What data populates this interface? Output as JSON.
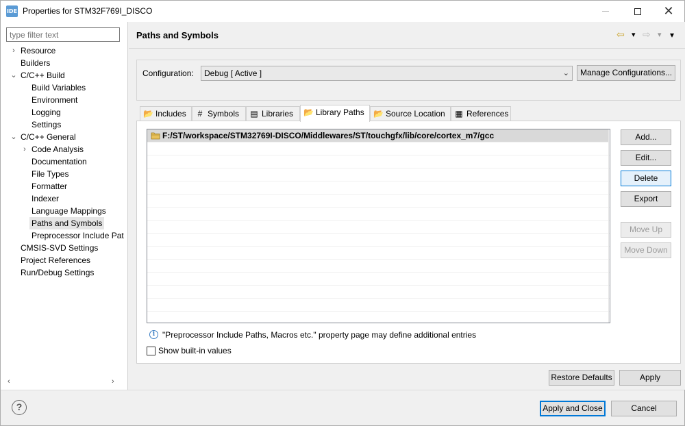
{
  "window": {
    "app_icon": "IDE",
    "title": "Properties for STM32F769I_DISCO",
    "minimize_icon": "minimize-icon",
    "maximize_icon": "maximize-icon",
    "close_glyph": "✕"
  },
  "sidebar": {
    "filter_placeholder": "type filter text",
    "items": [
      {
        "label": "Resource",
        "expander": "›"
      },
      {
        "label": "Builders"
      },
      {
        "label": "C/C++ Build",
        "expander": "⌄"
      },
      {
        "label": "Build Variables"
      },
      {
        "label": "Environment"
      },
      {
        "label": "Logging"
      },
      {
        "label": "Settings"
      },
      {
        "label": "C/C++ General",
        "expander": "⌄"
      },
      {
        "label": "Code Analysis",
        "expander": "›"
      },
      {
        "label": "Documentation"
      },
      {
        "label": "File Types"
      },
      {
        "label": "Formatter"
      },
      {
        "label": "Indexer"
      },
      {
        "label": "Language Mappings"
      },
      {
        "label": "Paths and Symbols",
        "selected": true
      },
      {
        "label": "Preprocessor Include Pat"
      },
      {
        "label": "CMSIS-SVD Settings"
      },
      {
        "label": "Project References"
      },
      {
        "label": "Run/Debug Settings"
      }
    ],
    "scroll_left": "‹",
    "scroll_right": "›"
  },
  "main": {
    "title": "Paths and Symbols",
    "nav": {
      "back": "⇦",
      "back_menu": "▾",
      "forward": "⇨",
      "forward_menu": "▾",
      "view_menu": "▾"
    },
    "configuration_label": "Configuration:",
    "configuration_value": "Debug  [ Active ]",
    "manage_button": "Manage Configurations...",
    "tabs": [
      {
        "label": "Includes",
        "icon": "includes-icon",
        "glyph": "📂"
      },
      {
        "label": "Symbols",
        "icon": "hash-icon",
        "glyph": "#"
      },
      {
        "label": "Libraries",
        "icon": "libraries-icon",
        "glyph": "▤"
      },
      {
        "label": "Library Paths",
        "icon": "folder-icon",
        "glyph": "📂",
        "active": true
      },
      {
        "label": "Source Location",
        "icon": "source-folder-icon",
        "glyph": "📂"
      },
      {
        "label": "References",
        "icon": "references-icon",
        "glyph": "▦"
      }
    ],
    "paths": [
      "F:/ST/workspace/STM32769I-DISCO/Middlewares/ST/touchgfx/lib/core/cortex_m7/gcc"
    ],
    "side_buttons": {
      "add": "Add...",
      "edit": "Edit...",
      "delete": "Delete",
      "export": "Export",
      "move_up": "Move Up",
      "move_down": "Move Down"
    },
    "info_text": "\"Preprocessor Include Paths, Macros etc.\" property page may define additional entries",
    "show_builtin_label": "Show built-in values",
    "show_builtin_checked": false,
    "restore_defaults": "Restore Defaults",
    "apply": "Apply"
  },
  "footer": {
    "help_glyph": "?",
    "apply_close": "Apply and Close",
    "cancel": "Cancel"
  },
  "colors": {
    "accent": "#0078d7",
    "selection": "#d9d9d9",
    "window_bg": "#f0f0f0"
  }
}
